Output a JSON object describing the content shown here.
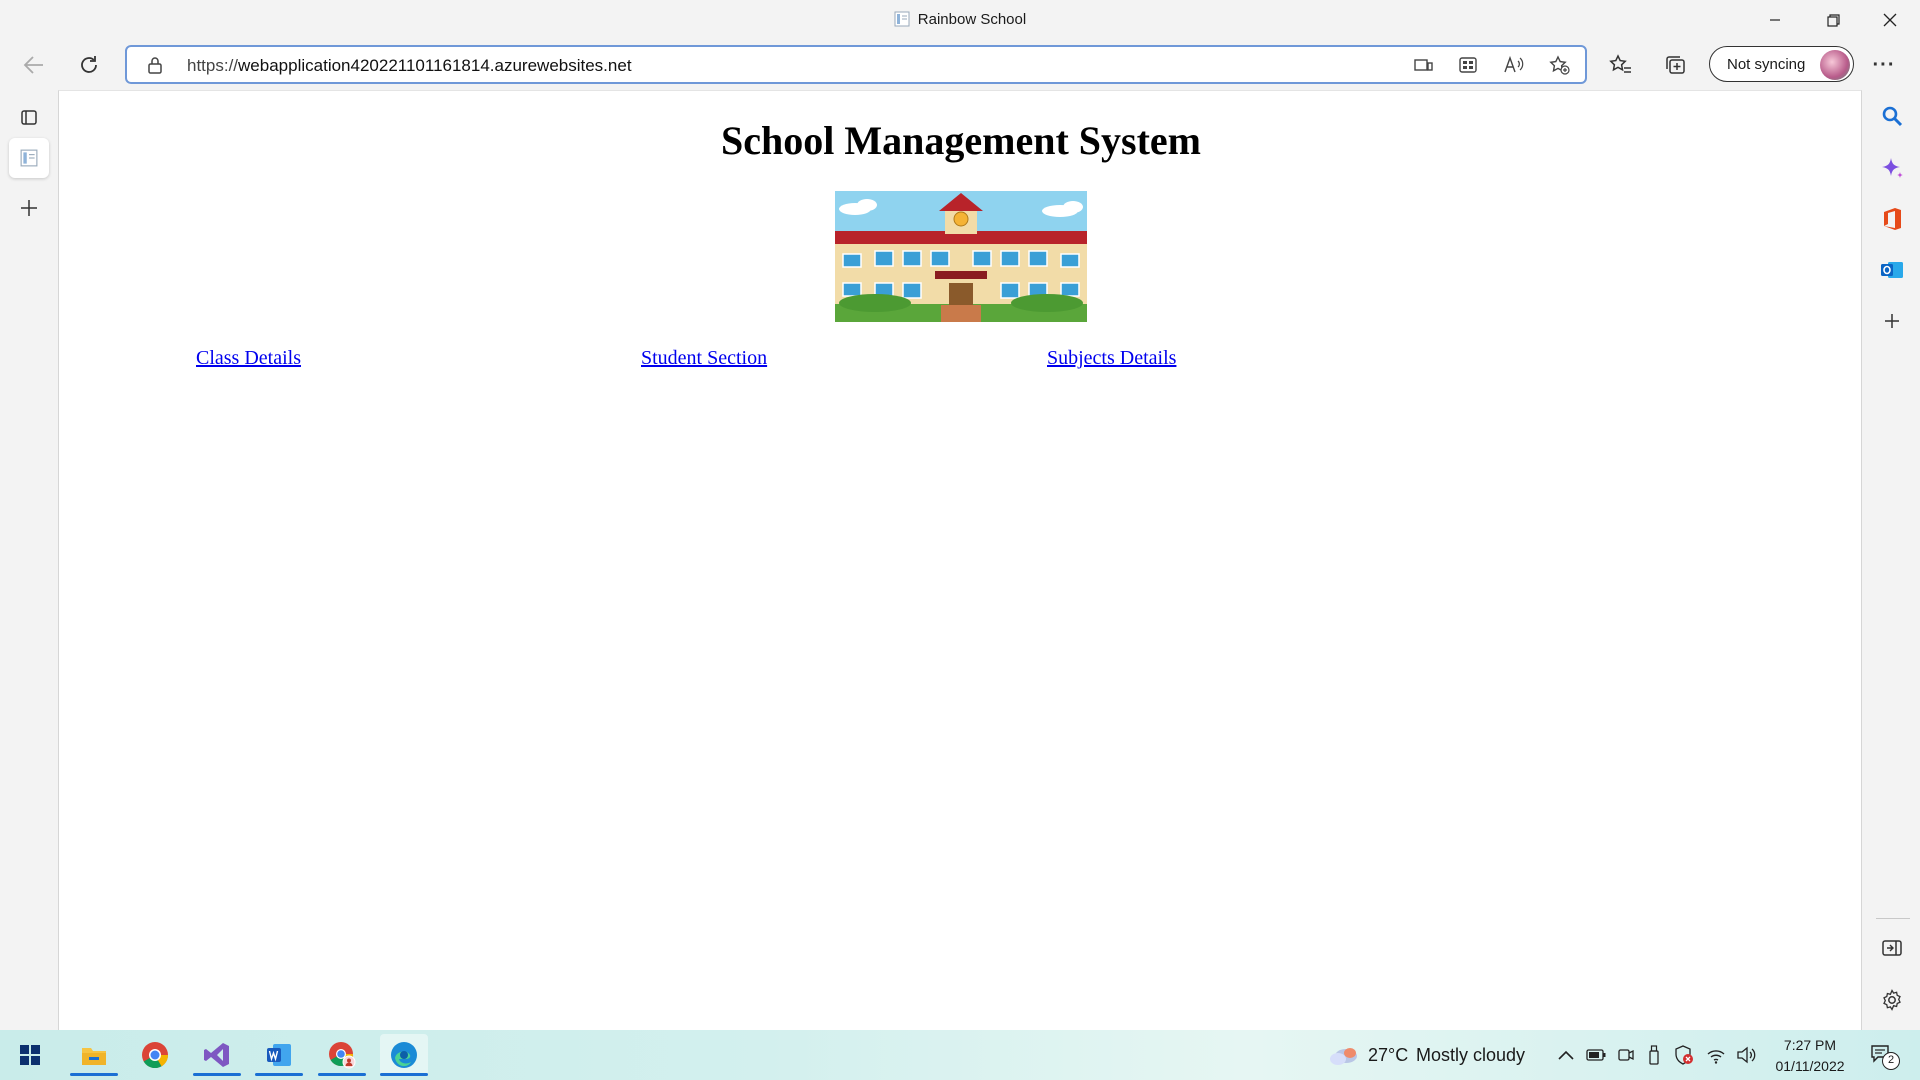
{
  "window": {
    "tab_title": "Rainbow School",
    "controls": [
      "minimize",
      "restore",
      "close"
    ]
  },
  "toolbar": {
    "url_prefix": "https://",
    "url_host": "webapplication420221101161814.azurewebsites.net",
    "sync_label": "Not syncing",
    "more_label": "···"
  },
  "page": {
    "heading": "School Management System",
    "image_icon": "school-building-illustration",
    "links": [
      {
        "label": "Class Details"
      },
      {
        "label": "Student Section"
      },
      {
        "label": "Subjects Details"
      }
    ]
  },
  "taskbar": {
    "apps": [
      "windows-start",
      "file-explorer",
      "chrome",
      "visual-studio",
      "word",
      "chrome-profile",
      "edge"
    ],
    "weather_temp": "27°C",
    "weather_condition": "Mostly cloudy",
    "time": "7:27 PM",
    "date": "01/11/2022",
    "notification_count": "2"
  },
  "colors": {
    "link": "#0000ee",
    "address_border": "#6f98d8",
    "taskbar_accent": "#1a6fd4"
  }
}
